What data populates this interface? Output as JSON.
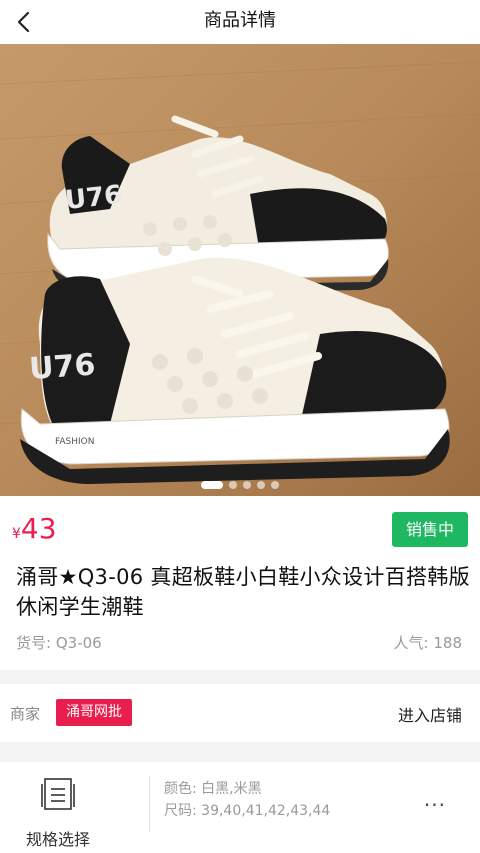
{
  "header": {
    "title": "商品详情"
  },
  "carousel": {
    "slide_count": 5,
    "active_index": 0
  },
  "product": {
    "currency": "¥",
    "price": "43",
    "status": "销售中",
    "title": "涌哥★Q3-06 真超板鞋小白鞋小众设计百搭韩版休闲学生潮鞋",
    "sku_label": "货号:",
    "sku": "Q3-06",
    "popularity_label": "人气:",
    "popularity": "188",
    "shoe_print": "U76",
    "shoe_brand_print": "FASHION"
  },
  "shop": {
    "label": "商家",
    "name": "涌哥网批",
    "enter_label": "进入店铺"
  },
  "spec": {
    "button_label": "规格选择",
    "color_label": "颜色:",
    "colors": "白黑,米黑",
    "size_label": "尺码:",
    "sizes": "39,40,41,42,43,44",
    "more": "···"
  },
  "colors": {
    "accent": "#e91e4f",
    "status_green": "#1fb862",
    "divider": "#f3f3f3"
  }
}
